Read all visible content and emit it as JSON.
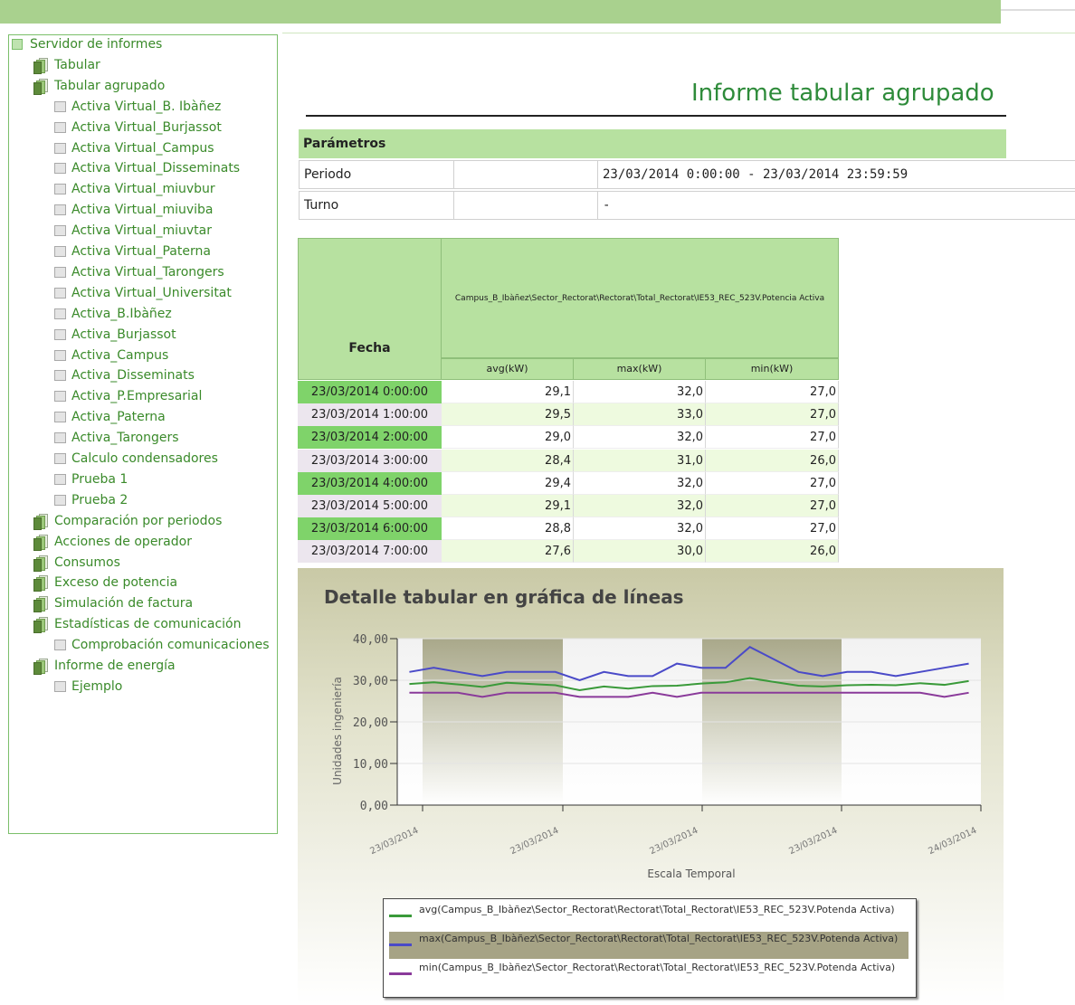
{
  "tree": {
    "root": "Servidor de informes",
    "items": [
      {
        "label": "Tabular",
        "type": "folder",
        "level": 1
      },
      {
        "label": "Tabular agrupado",
        "type": "folder",
        "level": 1
      },
      {
        "label": "Activa Virtual_B. Ibàñez",
        "type": "doc",
        "level": 2
      },
      {
        "label": "Activa Virtual_Burjassot",
        "type": "doc",
        "level": 2
      },
      {
        "label": "Activa Virtual_Campus",
        "type": "doc",
        "level": 2
      },
      {
        "label": "Activa Virtual_Disseminats",
        "type": "doc",
        "level": 2
      },
      {
        "label": "Activa Virtual_miuvbur",
        "type": "doc",
        "level": 2
      },
      {
        "label": "Activa Virtual_miuviba",
        "type": "doc",
        "level": 2
      },
      {
        "label": "Activa Virtual_miuvtar",
        "type": "doc",
        "level": 2
      },
      {
        "label": "Activa Virtual_Paterna",
        "type": "doc",
        "level": 2
      },
      {
        "label": "Activa Virtual_Tarongers",
        "type": "doc",
        "level": 2
      },
      {
        "label": "Activa Virtual_Universitat",
        "type": "doc",
        "level": 2
      },
      {
        "label": "Activa_B.Ibàñez",
        "type": "doc",
        "level": 2
      },
      {
        "label": "Activa_Burjassot",
        "type": "doc",
        "level": 2
      },
      {
        "label": "Activa_Campus",
        "type": "doc",
        "level": 2
      },
      {
        "label": "Activa_Disseminats",
        "type": "doc",
        "level": 2
      },
      {
        "label": "Activa_P.Empresarial",
        "type": "doc",
        "level": 2
      },
      {
        "label": "Activa_Paterna",
        "type": "doc",
        "level": 2
      },
      {
        "label": "Activa_Tarongers",
        "type": "doc",
        "level": 2
      },
      {
        "label": "Calculo condensadores",
        "type": "doc",
        "level": 2
      },
      {
        "label": "Prueba 1",
        "type": "doc",
        "level": 2
      },
      {
        "label": "Prueba 2",
        "type": "doc",
        "level": 2
      },
      {
        "label": "Comparación por periodos",
        "type": "folder",
        "level": 1
      },
      {
        "label": "Acciones de operador",
        "type": "folder",
        "level": 1
      },
      {
        "label": "Consumos",
        "type": "folder",
        "level": 1
      },
      {
        "label": "Exceso de potencia",
        "type": "folder",
        "level": 1
      },
      {
        "label": "Simulación de factura",
        "type": "folder",
        "level": 1
      },
      {
        "label": "Estadísticas de comunicación",
        "type": "folder",
        "level": 1
      },
      {
        "label": "Comprobación comunicaciones",
        "type": "doc",
        "level": 2
      },
      {
        "label": "Informe de energía",
        "type": "folder",
        "level": 1
      },
      {
        "label": "Ejemplo",
        "type": "doc",
        "level": 2
      }
    ]
  },
  "report": {
    "title": "Informe tabular agrupado",
    "params_header": "Parámetros",
    "params": [
      {
        "label": "Periodo",
        "value": "23/03/2014 0:00:00 - 23/03/2014 23:59:59"
      },
      {
        "label": "Turno",
        "value": "-"
      }
    ]
  },
  "table": {
    "date_header": "Fecha",
    "group_header": "Campus_B_Ibàñez\\Sector_Rectorat\\Rectorat\\Total_Rectorat\\IE53_REC_523V.Potencia Activa",
    "sub_headers": [
      "avg(kW)",
      "max(kW)",
      "min(kW)"
    ],
    "rows": [
      {
        "date": "23/03/2014 0:00:00",
        "avg": "29,1",
        "max": "32,0",
        "min": "27,0"
      },
      {
        "date": "23/03/2014 1:00:00",
        "avg": "29,5",
        "max": "33,0",
        "min": "27,0"
      },
      {
        "date": "23/03/2014 2:00:00",
        "avg": "29,0",
        "max": "32,0",
        "min": "27,0"
      },
      {
        "date": "23/03/2014 3:00:00",
        "avg": "28,4",
        "max": "31,0",
        "min": "26,0"
      },
      {
        "date": "23/03/2014 4:00:00",
        "avg": "29,4",
        "max": "32,0",
        "min": "27,0"
      },
      {
        "date": "23/03/2014 5:00:00",
        "avg": "29,1",
        "max": "32,0",
        "min": "27,0"
      },
      {
        "date": "23/03/2014 6:00:00",
        "avg": "28,8",
        "max": "32,0",
        "min": "27,0"
      },
      {
        "date": "23/03/2014 7:00:00",
        "avg": "27,6",
        "max": "30,0",
        "min": "26,0"
      }
    ]
  },
  "chart_data": {
    "type": "line",
    "title": "Detalle tabular en gráfica de líneas",
    "xlabel": "Escala Temporal",
    "ylabel": "Unidades ingeniería",
    "ylim": [
      0,
      40
    ],
    "yticks": [
      "0,00",
      "10,00",
      "20,00",
      "30,00",
      "40,00"
    ],
    "xticks": [
      "23/03/2014",
      "23/03/2014",
      "23/03/2014",
      "23/03/2014",
      "24/03/2014"
    ],
    "x_hours": [
      0,
      1,
      2,
      3,
      4,
      5,
      6,
      7,
      8,
      9,
      10,
      11,
      12,
      13,
      14,
      15,
      16,
      17,
      18,
      19,
      20,
      21,
      22,
      23
    ],
    "series": [
      {
        "name": "avg(Campus_B_Ibàñez\\Sector_Rectorat\\Rectorat\\Total_Rectorat\\IE53_REC_523V.Potenda Activa)",
        "color": "#3a9a3a",
        "values": [
          29.1,
          29.5,
          29.0,
          28.4,
          29.4,
          29.1,
          28.8,
          27.6,
          28.5,
          28.0,
          28.6,
          28.7,
          29.2,
          29.5,
          30.5,
          29.6,
          28.7,
          28.5,
          28.8,
          28.9,
          28.8,
          29.3,
          28.9,
          29.8
        ]
      },
      {
        "name": "max(Campus_B_Ibàñez\\Sector_Rectorat\\Rectorat\\Total_Rectorat\\IE53_REC_523V.Potenda Activa)",
        "color": "#4a4ac8",
        "values": [
          32.0,
          33.0,
          32.0,
          31.0,
          32.0,
          32.0,
          32.0,
          30.0,
          32.0,
          31.0,
          31.0,
          34.0,
          33.0,
          33.0,
          38.0,
          35.0,
          32.0,
          31.0,
          32.0,
          32.0,
          31.0,
          32.0,
          33.0,
          34.0
        ]
      },
      {
        "name": "min(Campus_B_Ibàñez\\Sector_Rectorat\\Rectorat\\Total_Rectorat\\IE53_REC_523V.Potenda Activa)",
        "color": "#8a3a9a",
        "values": [
          27.0,
          27.0,
          27.0,
          26.0,
          27.0,
          27.0,
          27.0,
          26.0,
          26.0,
          26.0,
          27.0,
          26.0,
          27.0,
          27.0,
          27.0,
          27.0,
          27.0,
          27.0,
          27.0,
          27.0,
          27.0,
          27.0,
          26.0,
          27.0
        ]
      }
    ],
    "legend_highlighted": 1,
    "grid": true
  }
}
